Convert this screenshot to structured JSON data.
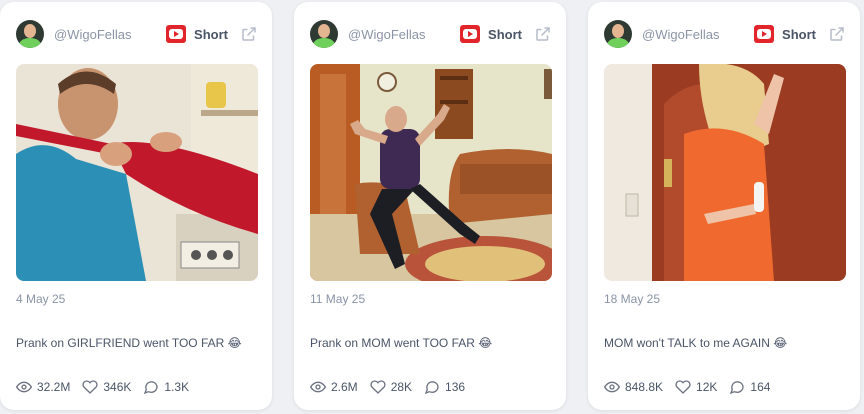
{
  "cards": [
    {
      "handle": "@WigoFellas",
      "platform": "Short",
      "date": "4 May 25",
      "title": "Prank on GIRLFRIEND went TOO FAR 😂",
      "views": "32.2M",
      "likes": "346K",
      "comments": "1.3K"
    },
    {
      "handle": "@WigoFellas",
      "platform": "Short",
      "date": "11 May 25",
      "title": "Prank on MOM went TOO FAR 😂",
      "views": "2.6M",
      "likes": "28K",
      "comments": "136"
    },
    {
      "handle": "@WigoFellas",
      "platform": "Short",
      "date": "18 May 25",
      "title": "MOM won't TALK to me AGAIN 😂",
      "views": "848.8K",
      "likes": "12K",
      "comments": "164"
    }
  ],
  "icons": {
    "platform": "youtube-icon",
    "external": "external-link-icon",
    "views": "eye-icon",
    "likes": "heart-icon",
    "comments": "comment-icon"
  },
  "colors": {
    "youtube_red": "#e1252a",
    "muted_text": "#8a94a6",
    "body_text": "#4a5568"
  }
}
